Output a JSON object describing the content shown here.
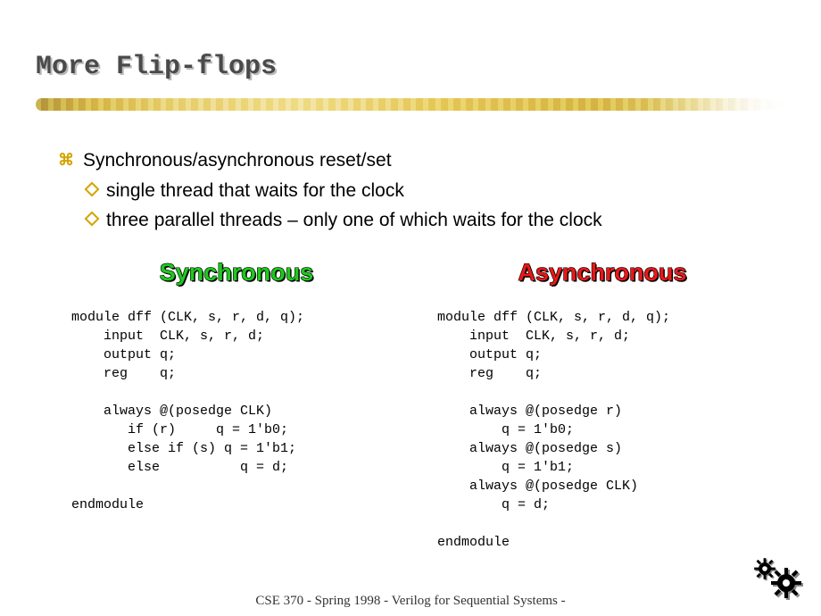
{
  "title": "More Flip-flops",
  "bullets": {
    "main": "Synchronous/asynchronous reset/set",
    "sub1": "single thread that waits for the clock",
    "sub2": "three parallel threads – only one of which waits for the clock"
  },
  "columns": {
    "sync": {
      "heading": "Synchronous",
      "code": "module dff (CLK, s, r, d, q);\n    input  CLK, s, r, d;\n    output q;\n    reg    q;\n\n    always @(posedge CLK)\n       if (r)     q = 1'b0;\n       else if (s) q = 1'b1;\n       else          q = d;\n\nendmodule"
    },
    "async": {
      "heading": "Asynchronous",
      "code": "module dff (CLK, s, r, d, q);\n    input  CLK, s, r, d;\n    output q;\n    reg    q;\n\n    always @(posedge r)\n        q = 1'b0;\n    always @(posedge s)\n        q = 1'b1;\n    always @(posedge CLK)\n        q = d;\n\nendmodule"
    }
  },
  "footer": "CSE 370 - Spring 1998 - Verilog for Sequential Systems -"
}
